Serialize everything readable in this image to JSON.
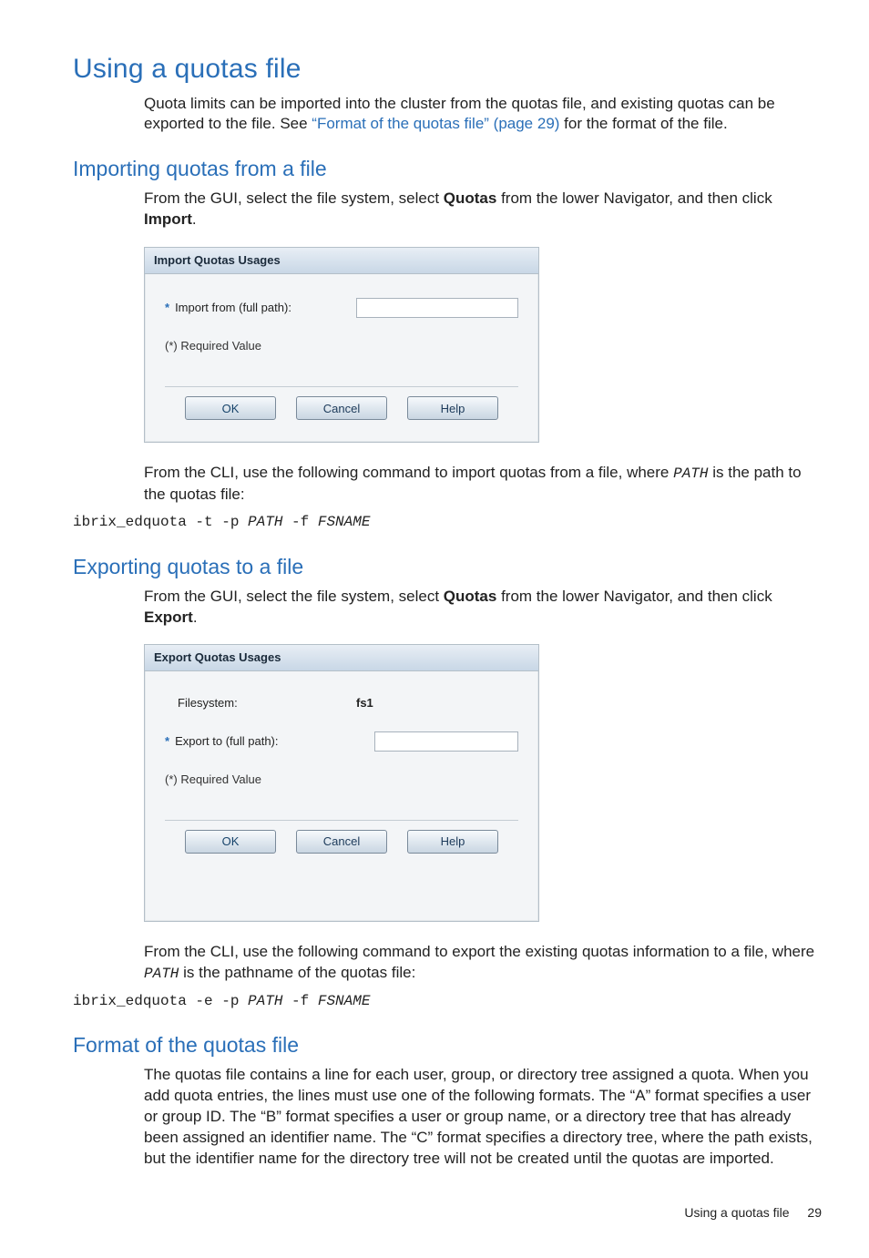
{
  "h1": "Using a quotas file",
  "intro_pre": "Quota limits can be imported into the cluster from the quotas file, and existing quotas can be exported to the file. See ",
  "intro_link": "“Format of the quotas file” (page 29)",
  "intro_post": " for the format of the file.",
  "sec_import_h": "Importing quotas from a file",
  "sec_import_p_pre": "From the GUI, select the file system, select ",
  "sec_import_p_b1": "Quotas",
  "sec_import_p_mid": " from the lower Navigator, and then click ",
  "sec_import_p_b2": "Import",
  "sec_import_p_end": ".",
  "dlg_import": {
    "title": "Import Quotas Usages",
    "field_label": "Import from (full path):",
    "note": "(*) Required Value",
    "ok": "OK",
    "cancel": "Cancel",
    "help": "Help"
  },
  "import_cli_p_pre": "From the CLI, use the following command to import quotas from a file, where ",
  "import_cli_p_path": "PATH",
  "import_cli_p_post": " is the path to the quotas file:",
  "import_cli_cmd_a": "ibrix_edquota -t -p ",
  "import_cli_cmd_b": "PATH",
  "import_cli_cmd_c": " -f ",
  "import_cli_cmd_d": "FSNAME",
  "sec_export_h": "Exporting quotas to a file",
  "sec_export_p_pre": "From the GUI, select the file system, select ",
  "sec_export_p_b1": "Quotas",
  "sec_export_p_mid": " from the lower Navigator, and then click ",
  "sec_export_p_b2": "Export",
  "sec_export_p_end": ".",
  "dlg_export": {
    "title": "Export Quotas Usages",
    "fs_label": "Filesystem:",
    "fs_value": "fs1",
    "field_label": "Export to (full path):",
    "note": "(*) Required Value",
    "ok": "OK",
    "cancel": "Cancel",
    "help": "Help"
  },
  "export_cli_p_pre": "From the CLI, use the following command to export the existing quotas information to a file, where ",
  "export_cli_p_path": "PATH",
  "export_cli_p_post": " is the pathname of the quotas file:",
  "export_cli_cmd_a": "ibrix_edquota -e -p ",
  "export_cli_cmd_b": "PATH",
  "export_cli_cmd_c": " -f ",
  "export_cli_cmd_d": "FSNAME",
  "sec_format_h": "Format of the quotas file",
  "sec_format_p": "The quotas file contains a line for each user, group, or directory tree assigned a quota. When you add quota entries, the lines must use one of the following formats. The “A” format specifies a user or group ID. The “B” format specifies a user or group name, or a directory tree that has already been assigned an identifier name. The “C” format specifies a directory tree, where the path exists, but the identifier name for the directory tree will not be created until the quotas are imported.",
  "footer_title": "Using a quotas file",
  "footer_page": "29"
}
